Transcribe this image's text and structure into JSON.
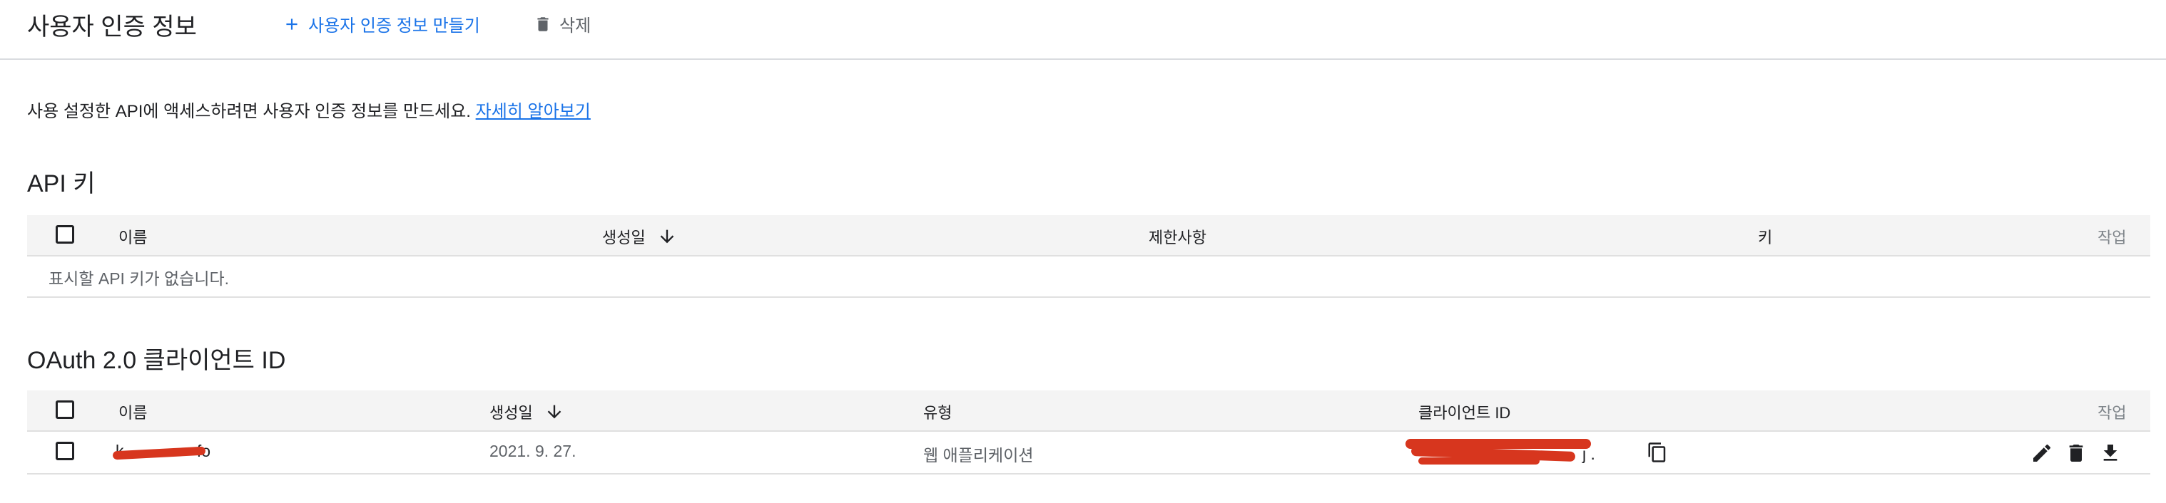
{
  "toolbar": {
    "title": "사용자 인증 정보",
    "create_label": "사용자 인증 정보 만들기",
    "delete_label": "삭제"
  },
  "info": {
    "text": "사용 설정한 API에 액세스하려면 사용자 인증 정보를 만드세요.",
    "link_label": "자세히 알아보기"
  },
  "api_keys": {
    "title": "API 키",
    "columns": [
      "이름",
      "생성일",
      "제한사항",
      "키",
      "작업"
    ],
    "empty_text": "표시할 API 키가 없습니다."
  },
  "oauth": {
    "title": "OAuth 2.0 클라이언트 ID",
    "columns": [
      "이름",
      "생성일",
      "유형",
      "클라이언트 ID",
      "작업"
    ],
    "rows": [
      {
        "name": "k",
        "name_suffix": "fo",
        "date": "2021. 9. 27.",
        "type": "웹 애플리케이션",
        "client_id_tail": "j  ."
      }
    ]
  },
  "icons": {
    "create": "plus-icon",
    "delete": "trash-icon",
    "sort": "arrow-down-icon",
    "copy": "copy-icon",
    "edit": "pencil-icon",
    "download": "download-icon"
  },
  "colors": {
    "accent": "#1a73e8",
    "redaction": "#d7361e"
  }
}
